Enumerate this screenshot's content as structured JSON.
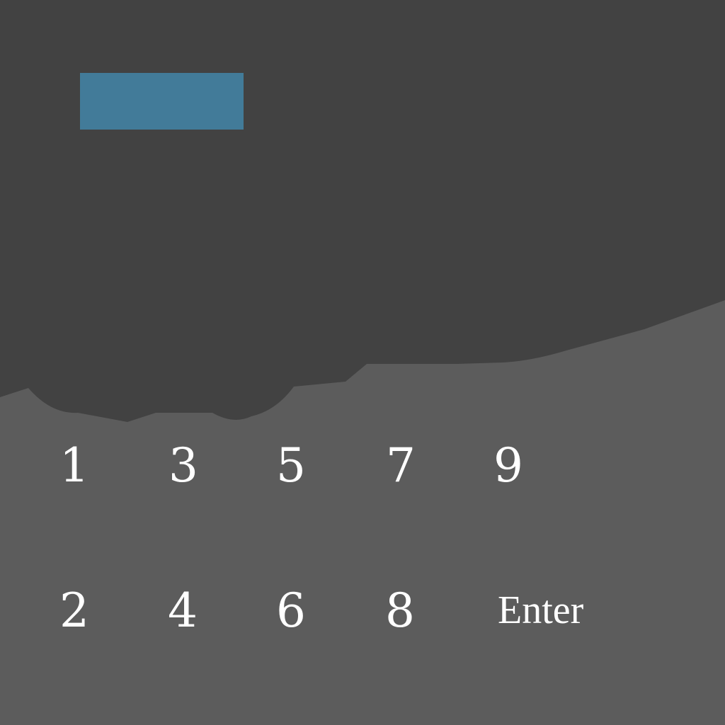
{
  "colors": {
    "sky": "#424242",
    "ground": "#5c5c5c",
    "display": "#427b99",
    "key_text": "#ffffff"
  },
  "display": {
    "value": ""
  },
  "keypad": {
    "row1": [
      "1",
      "3",
      "5",
      "7",
      "9"
    ],
    "row2": [
      "2",
      "4",
      "6",
      "8"
    ],
    "enter_label": "Enter"
  }
}
